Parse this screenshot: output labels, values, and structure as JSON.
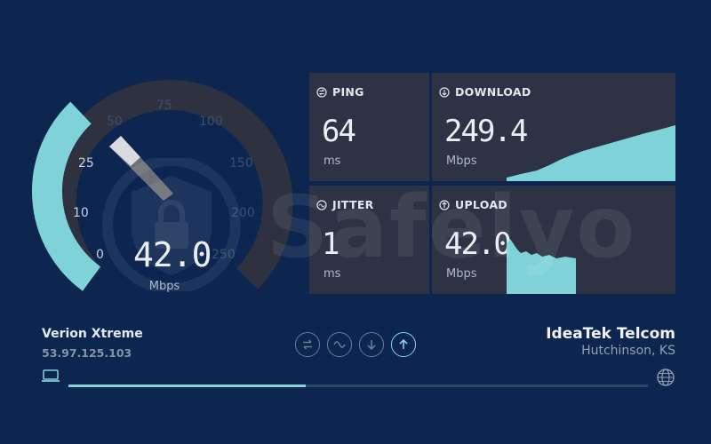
{
  "gauge": {
    "ticks": [
      "0",
      "10",
      "25",
      "50",
      "75",
      "100",
      "150",
      "200",
      "250"
    ],
    "speed": "42.0",
    "unit": "Mbps",
    "accent_color": "#7fd3d8"
  },
  "cards": {
    "ping": {
      "label": "PING",
      "value": "64",
      "unit": "ms",
      "icon": "ping-icon"
    },
    "download": {
      "label": "DOWNLOAD",
      "value": "249.4",
      "unit": "Mbps",
      "icon": "download-arrow-icon"
    },
    "jitter": {
      "label": "JITTER",
      "value": "1",
      "unit": "ms",
      "icon": "jitter-icon"
    },
    "upload": {
      "label": "UPLOAD",
      "value": "42.0",
      "unit": "Mbps",
      "icon": "upload-arrow-icon"
    }
  },
  "watermark": {
    "text": "Safelyo"
  },
  "client": {
    "name": "Verion Xtreme",
    "ip": "53.97.125.103"
  },
  "server": {
    "name": "IdeaTek Telcom",
    "location": "Hutchinson, KS"
  },
  "steps": [
    "ping-step",
    "jitter-step",
    "download-step",
    "upload-step"
  ],
  "test_progress": 0.41
}
